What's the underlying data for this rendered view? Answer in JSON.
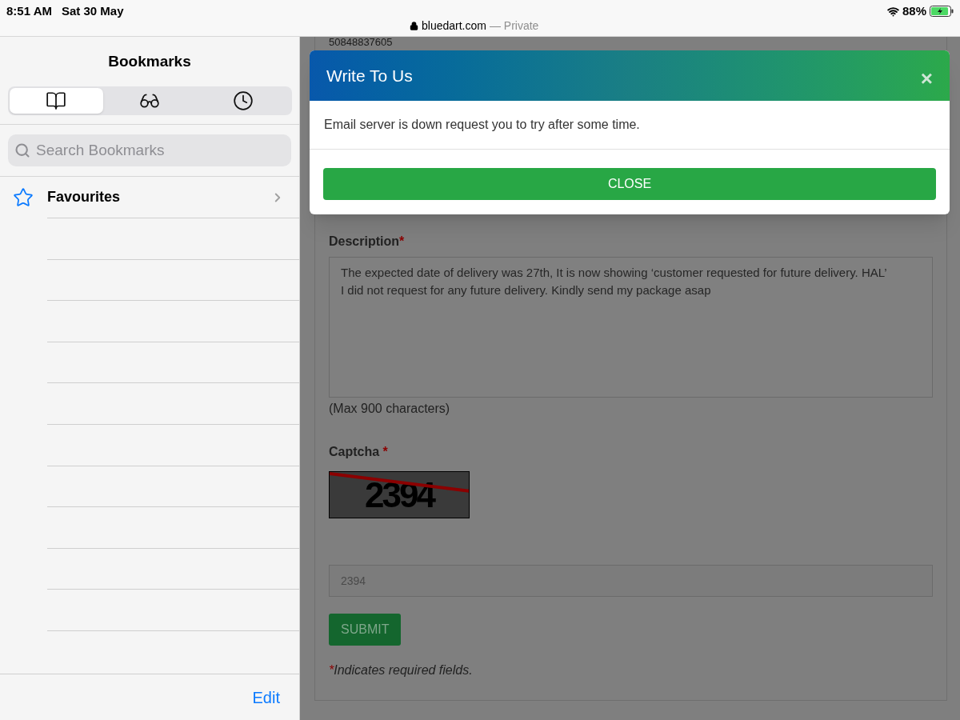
{
  "status_bar": {
    "time": "8:51 AM",
    "date": "Sat 30 May",
    "url": "bluedart.com",
    "mode": "— Private",
    "battery": "88%"
  },
  "sidebar": {
    "title": "Bookmarks",
    "tabs": [
      {
        "kind": "bookmarks",
        "selected": true
      },
      {
        "kind": "reading_list",
        "selected": false
      },
      {
        "kind": "history",
        "selected": false
      }
    ],
    "search": {
      "placeholder": "Search Bookmarks"
    },
    "items": [
      {
        "label": "Favourites"
      }
    ],
    "edit": "Edit"
  },
  "page": {
    "tracking_number": "50848837605",
    "description": {
      "label": "Description",
      "required_mark": "*",
      "value": "The expected date of delivery was 27th, It is now showing ‘customer requested for future delivery. HAL’\nI did not request for any future delivery. Kindly send my package asap",
      "hint": "(Max 900 characters)"
    },
    "captcha": {
      "label": "Captcha",
      "required_mark": "*",
      "image_text": "2394",
      "value": "2394"
    },
    "submit": "SUBMIT",
    "note": {
      "mark": "*",
      "text": "Indicates required fields."
    }
  },
  "modal": {
    "title": "Write To Us",
    "close_icon": "×",
    "message": "Email server is down request you to try after some time.",
    "button": "CLOSE"
  }
}
